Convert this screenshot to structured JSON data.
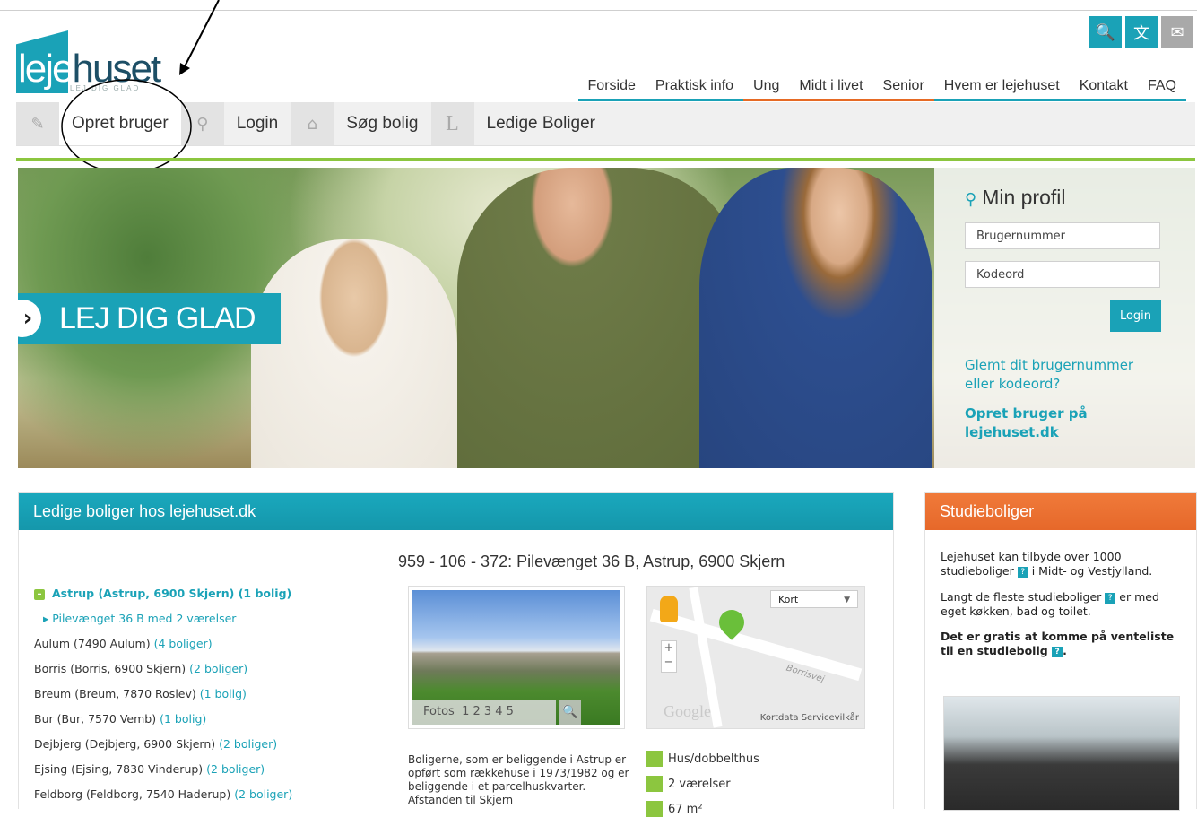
{
  "logo": {
    "brand_highlight": "leje",
    "brand_rest": "huset",
    "tagline": "LEJ DIG GLAD"
  },
  "top_icons": [
    "search-icon",
    "translate-icon",
    "mail-icon"
  ],
  "main_nav": [
    {
      "label": "Forside",
      "accent": "#1aa2b7"
    },
    {
      "label": "Praktisk info",
      "accent": "#1aa2b7"
    },
    {
      "label": "Ung",
      "accent": "#e66a24"
    },
    {
      "label": "Midt i livet",
      "accent": "#e66a24"
    },
    {
      "label": "Senior",
      "accent": "#e66a24"
    },
    {
      "label": "Hvem er lejehuset",
      "accent": "#1aa2b7"
    },
    {
      "label": "Kontakt",
      "accent": "#1aa2b7"
    },
    {
      "label": "FAQ",
      "accent": "#1aa2b7"
    }
  ],
  "sub_nav": [
    {
      "icon": "edit-icon",
      "label": "Opret bruger"
    },
    {
      "icon": "key-icon",
      "label": "Login"
    },
    {
      "icon": "home-icon",
      "label": "Søg bolig"
    },
    {
      "icon": "letter-l-icon",
      "label": "Ledige Boliger"
    }
  ],
  "hero": {
    "tagline": "LEJ DIG GLAD"
  },
  "login": {
    "title": "Min profil",
    "user_placeholder": "Brugernummer",
    "pass_placeholder": "Kodeord",
    "button": "Login",
    "forgot": "Glemt dit brugernummer eller kodeord?",
    "create": "Opret bruger på lejehuset.dk"
  },
  "listings": {
    "header": "Ledige boliger hos lejehuset.dk",
    "open_town": "Astrup (Astrup, 6900 Skjern) (1 bolig)",
    "open_sub": "Pilevænget 36 B med 2 værelser",
    "towns": [
      {
        "name": "Aulum (7490 Aulum)",
        "count": "(4 boliger)"
      },
      {
        "name": "Borris (Borris, 6900 Skjern)",
        "count": "(2 boliger)"
      },
      {
        "name": "Breum (Breum, 7870 Roslev)",
        "count": "(1 bolig)"
      },
      {
        "name": "Bur (Bur, 7570 Vemb)",
        "count": "(1 bolig)"
      },
      {
        "name": "Dejbjerg (Dejbjerg, 6900 Skjern)",
        "count": "(2 boliger)"
      },
      {
        "name": "Ejsing (Ejsing, 7830 Vinderup)",
        "count": "(2 boliger)"
      },
      {
        "name": "Feldborg (Feldborg, 7540 Haderup)",
        "count": "(2 boliger)"
      }
    ],
    "property_title": "959 - 106 - 372: Pilevænget 36 B, Astrup, 6900 Skjern",
    "photos_label": "Fotos",
    "photo_pages": "1 2 3 4 5",
    "map": {
      "type_select": "Kort",
      "street": "Borrisvej",
      "logo": "Google",
      "footer": "Kortdata  Servicevilkår"
    },
    "description": "Boligerne, som er beliggende i Astrup er opført som rækkehuse i 1973/1982 og er beliggende i et parcelhuskvarter. Afstanden til Skjern",
    "facts": [
      "Hus/dobbelthus",
      "2 værelser",
      "67 m²"
    ]
  },
  "studie": {
    "header": "Studieboliger",
    "p1a": "Lejehuset kan tilbyde over 1000 studieboliger",
    "p1b": "i Midt- og Vestjylland.",
    "p2a": "Langt de fleste studieboliger",
    "p2b": "er med eget køkken, bad og toilet.",
    "p3": "Det er gratis at komme på venteliste til en studiebolig",
    "help_mark": "?"
  },
  "colors": {
    "teal": "#1aa2b7",
    "orange": "#e66a24",
    "green": "#8cc63f"
  }
}
